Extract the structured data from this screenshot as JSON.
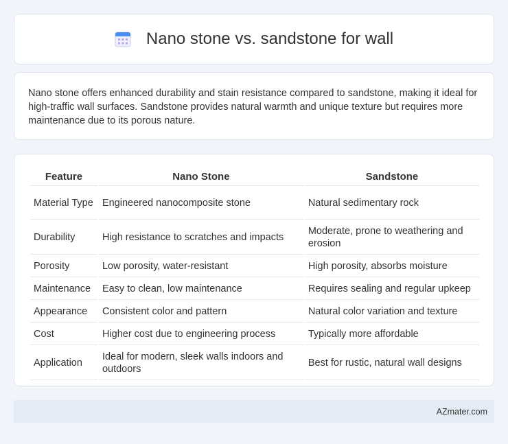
{
  "header": {
    "title": "Nano stone vs. sandstone for wall",
    "icon": "calendar-icon"
  },
  "summary": {
    "text": "Nano stone offers enhanced durability and stain resistance compared to sandstone, making it ideal for high-traffic wall surfaces. Sandstone provides natural warmth and unique texture but requires more maintenance due to its porous nature."
  },
  "table": {
    "headers": [
      "Feature",
      "Nano Stone",
      "Sandstone"
    ],
    "rows": [
      [
        "Material Type",
        "Engineered nanocomposite stone",
        "Natural sedimentary rock"
      ],
      [
        "Durability",
        "High resistance to scratches and impacts",
        "Moderate, prone to weathering and erosion"
      ],
      [
        "Porosity",
        "Low porosity, water-resistant",
        "High porosity, absorbs moisture"
      ],
      [
        "Maintenance",
        "Easy to clean, low maintenance",
        "Requires sealing and regular upkeep"
      ],
      [
        "Appearance",
        "Consistent color and pattern",
        "Natural color variation and texture"
      ],
      [
        "Cost",
        "Higher cost due to engineering process",
        "Typically more affordable"
      ],
      [
        "Application",
        "Ideal for modern, sleek walls indoors and outdoors",
        "Best for rustic, natural wall designs"
      ]
    ]
  },
  "footer": {
    "brand": "AZmater.com"
  }
}
